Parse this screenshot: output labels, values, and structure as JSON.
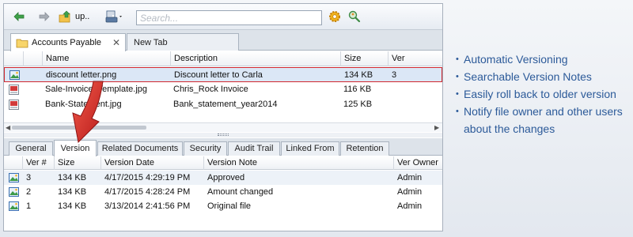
{
  "toolbar": {
    "up_label": "up..",
    "search_placeholder": "Search..."
  },
  "doc_tabs": [
    {
      "label": "Accounts Payable",
      "active": true
    },
    {
      "label": "New Tab",
      "active": false
    }
  ],
  "files": {
    "columns": [
      "Name",
      "Description",
      "Size",
      "Ver"
    ],
    "rows": [
      {
        "name": "discount letter.png",
        "description": "Discount letter to Carla",
        "size": "134 KB",
        "ver": "3",
        "selected": true
      },
      {
        "name": "Sale-Invoice_Template.jpg",
        "description": "Chris_Rock Invoice",
        "size": "116 KB",
        "ver": ""
      },
      {
        "name": "Bank-Statement.jpg",
        "description": "Bank_statement_year2014",
        "size": "125 KB",
        "ver": ""
      }
    ]
  },
  "property_tabs": [
    "General",
    "Version",
    "Related Documents",
    "Security",
    "Audit Trail",
    "Linked From",
    "Retention"
  ],
  "active_property_tab": "Version",
  "versions": {
    "columns": [
      "Ver #",
      "Size",
      "Version Date",
      "Version Note",
      "Ver Owner"
    ],
    "rows": [
      {
        "ver": "3",
        "size": "134 KB",
        "date": "4/17/2015 4:29:19 PM",
        "note": "Approved",
        "owner": "Admin"
      },
      {
        "ver": "2",
        "size": "134 KB",
        "date": "4/17/2015 4:28:24 PM",
        "note": "Amount changed",
        "owner": "Admin"
      },
      {
        "ver": "1",
        "size": "134 KB",
        "date": "3/13/2014 2:41:56 PM",
        "note": "Original file",
        "owner": "Admin"
      }
    ]
  },
  "features": [
    "Automatic Versioning",
    "Searchable Version Notes",
    "Easily roll back to older version",
    "Notify file owner and other users about the changes"
  ],
  "colors": {
    "accent_red": "#d2282e",
    "feature_text": "#2c5a99",
    "selection": "#dbe7f6"
  }
}
